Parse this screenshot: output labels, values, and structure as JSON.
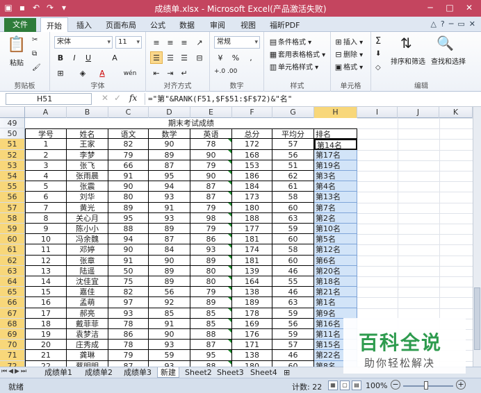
{
  "window": {
    "title": "成绩单.xlsx - Microsoft Excel(产品激活失败)",
    "accent": "#c4455f"
  },
  "ribbon_tabs": {
    "file": "文件",
    "tabs": [
      "开始",
      "插入",
      "页面布局",
      "公式",
      "数据",
      "审阅",
      "视图",
      "福昕PDF"
    ],
    "active": "开始"
  },
  "ribbon": {
    "clipboard": {
      "paste": "粘贴",
      "label": "剪贴板"
    },
    "font": {
      "name": "宋体",
      "size": "11",
      "bold": "B",
      "italic": "I",
      "underline": "U",
      "grow": "A",
      "color": "A",
      "wen": "wén",
      "label": "字体"
    },
    "alignment": {
      "label": "对齐方式"
    },
    "number": {
      "format": "常规",
      "percent": "%",
      "comma": ",",
      "inc": "+.0 .00",
      "label": "数字"
    },
    "styles": {
      "conditional": "条件格式",
      "table": "套用表格格式",
      "cell": "单元格样式",
      "label": "样式"
    },
    "cells": {
      "insert": "插入",
      "delete": "删除",
      "format": "格式",
      "label": "单元格"
    },
    "editing": {
      "sigma": "Σ",
      "sort": "排序和筛选",
      "find": "查找和选择",
      "label": "编辑"
    }
  },
  "formula_bar": {
    "name_box": "H51",
    "fx": "fx",
    "formula": "=\"第\"&RANK(F51,$F$51:$F$72)&\"名\""
  },
  "sheet": {
    "columns": [
      "A",
      "B",
      "C",
      "D",
      "E",
      "F",
      "G",
      "H",
      "I",
      "J",
      "K"
    ],
    "selected_column": "H",
    "title_row": "49",
    "title": "期末考试成绩",
    "header_row": "50",
    "headers": [
      "学号",
      "姓名",
      "语文",
      "数学",
      "英语",
      "总分",
      "平均分",
      "排名"
    ],
    "active_cell": "H51",
    "rows": [
      {
        "r": "51",
        "id": "1",
        "name": "王家",
        "c": "82",
        "m": "90",
        "e": "78",
        "t": "172",
        "a": "57",
        "rank": "第14名"
      },
      {
        "r": "52",
        "id": "2",
        "name": "李梦",
        "c": "79",
        "m": "89",
        "e": "90",
        "t": "168",
        "a": "56",
        "rank": "第17名"
      },
      {
        "r": "53",
        "id": "3",
        "name": "张飞",
        "c": "66",
        "m": "87",
        "e": "79",
        "t": "153",
        "a": "51",
        "rank": "第19名"
      },
      {
        "r": "54",
        "id": "4",
        "name": "张雨晨",
        "c": "91",
        "m": "95",
        "e": "90",
        "t": "186",
        "a": "62",
        "rank": "第3名"
      },
      {
        "r": "55",
        "id": "5",
        "name": "张震",
        "c": "90",
        "m": "94",
        "e": "87",
        "t": "184",
        "a": "61",
        "rank": "第4名"
      },
      {
        "r": "56",
        "id": "6",
        "name": "刘华",
        "c": "80",
        "m": "93",
        "e": "87",
        "t": "173",
        "a": "58",
        "rank": "第13名"
      },
      {
        "r": "57",
        "id": "7",
        "name": "黄光",
        "c": "89",
        "m": "91",
        "e": "79",
        "t": "180",
        "a": "60",
        "rank": "第7名"
      },
      {
        "r": "58",
        "id": "8",
        "name": "关心月",
        "c": "95",
        "m": "93",
        "e": "98",
        "t": "188",
        "a": "63",
        "rank": "第2名"
      },
      {
        "r": "59",
        "id": "9",
        "name": "陈小小",
        "c": "88",
        "m": "89",
        "e": "79",
        "t": "177",
        "a": "59",
        "rank": "第10名"
      },
      {
        "r": "60",
        "id": "10",
        "name": "冯余魏",
        "c": "94",
        "m": "87",
        "e": "86",
        "t": "181",
        "a": "60",
        "rank": "第5名"
      },
      {
        "r": "61",
        "id": "11",
        "name": "邓婷",
        "c": "90",
        "m": "84",
        "e": "93",
        "t": "174",
        "a": "58",
        "rank": "第12名"
      },
      {
        "r": "62",
        "id": "12",
        "name": "张章",
        "c": "91",
        "m": "90",
        "e": "89",
        "t": "181",
        "a": "60",
        "rank": "第6名"
      },
      {
        "r": "63",
        "id": "13",
        "name": "陆遥",
        "c": "50",
        "m": "89",
        "e": "80",
        "t": "139",
        "a": "46",
        "rank": "第20名"
      },
      {
        "r": "64",
        "id": "14",
        "name": "沈佳宜",
        "c": "75",
        "m": "89",
        "e": "80",
        "t": "164",
        "a": "55",
        "rank": "第18名"
      },
      {
        "r": "65",
        "id": "15",
        "name": "嘉佳",
        "c": "82",
        "m": "56",
        "e": "79",
        "t": "138",
        "a": "46",
        "rank": "第21名"
      },
      {
        "r": "66",
        "id": "16",
        "name": "孟萌",
        "c": "97",
        "m": "92",
        "e": "89",
        "t": "189",
        "a": "63",
        "rank": "第1名"
      },
      {
        "r": "67",
        "id": "17",
        "name": "郝亮",
        "c": "93",
        "m": "85",
        "e": "85",
        "t": "178",
        "a": "59",
        "rank": "第9名"
      },
      {
        "r": "68",
        "id": "18",
        "name": "戴菲菲",
        "c": "78",
        "m": "91",
        "e": "85",
        "t": "169",
        "a": "56",
        "rank": "第16名"
      },
      {
        "r": "69",
        "id": "19",
        "name": "袁梦洁",
        "c": "86",
        "m": "90",
        "e": "88",
        "t": "176",
        "a": "59",
        "rank": "第11名"
      },
      {
        "r": "70",
        "id": "20",
        "name": "庄秀成",
        "c": "78",
        "m": "93",
        "e": "87",
        "t": "171",
        "a": "57",
        "rank": "第15名"
      },
      {
        "r": "71",
        "id": "21",
        "name": "龚琳",
        "c": "79",
        "m": "59",
        "e": "95",
        "t": "138",
        "a": "46",
        "rank": "第22名"
      },
      {
        "r": "72",
        "id": "22",
        "name": "蔡明明",
        "c": "87",
        "m": "93",
        "e": "88",
        "t": "180",
        "a": "60",
        "rank": "第8名"
      }
    ]
  },
  "sheet_tabs": [
    "成绩单1",
    "成绩单2",
    "成绩单3",
    "新建",
    "Sheet2",
    "Sheet3",
    "Sheet4"
  ],
  "active_sheet": "新建",
  "status": {
    "ready": "就绪",
    "count": "计数: 22",
    "zoom": "100%"
  },
  "watermark": {
    "big": "百科全说",
    "small": "助你轻松解决"
  }
}
